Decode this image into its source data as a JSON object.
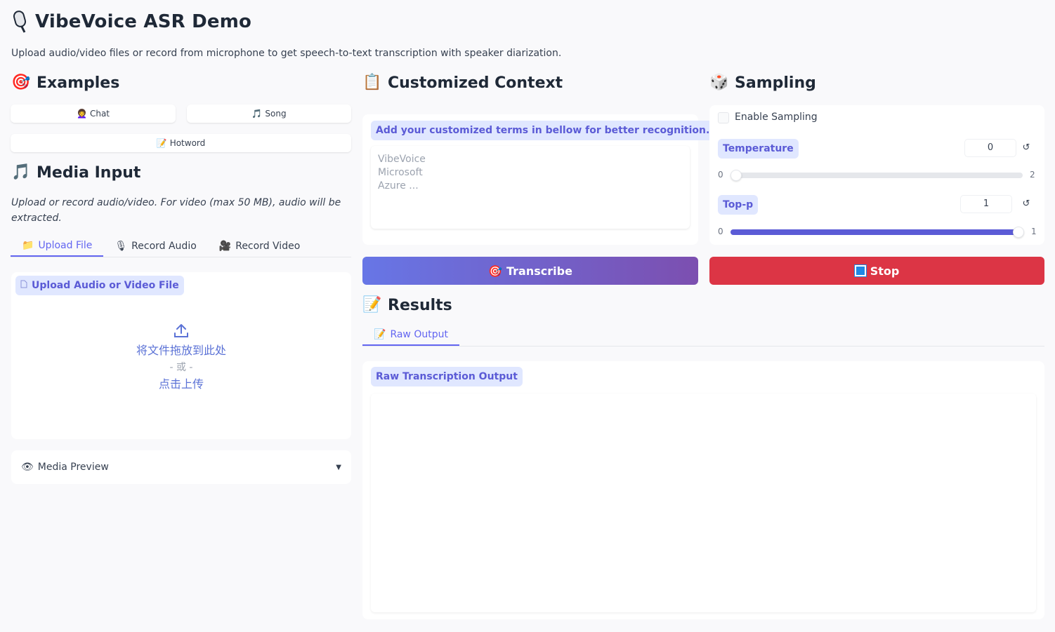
{
  "app": {
    "title": "VibeVoice ASR Demo",
    "subtitle": "Upload audio/video files or record from microphone to get speech-to-text transcription with speaker diarization."
  },
  "examples": {
    "heading": "Examples",
    "icon": "target-icon",
    "buttons": [
      {
        "icon": "👩‍🦱",
        "label": "Chat"
      },
      {
        "icon": "🎵",
        "label": "Song"
      },
      {
        "icon": "📝",
        "label": "Hotword"
      }
    ]
  },
  "media_input": {
    "heading": "Media Input",
    "hint": "Upload or record audio/video. For video (max 50 MB), audio will be extracted.",
    "tabs": [
      {
        "icon": "📁",
        "label": "Upload File",
        "active": true
      },
      {
        "icon": "🎙",
        "label": "Record Audio",
        "active": false
      },
      {
        "icon": "🎥",
        "label": "Record Video",
        "active": false
      }
    ],
    "upload_label": "Upload Audio or Video File",
    "drop_text": "将文件拖放到此处",
    "or_text": "- 或 -",
    "click_text": "点击上传",
    "preview_label": "Media Preview",
    "preview_icon": "👁",
    "caret": "▼"
  },
  "context": {
    "heading": "Customized Context",
    "label": "Add your customized terms in bellow for better recognition.",
    "placeholder": "VibeVoice\nMicrosoft\nAzure ..."
  },
  "sampling": {
    "heading": "Sampling",
    "enable_label": "Enable Sampling",
    "enabled": false,
    "temperature": {
      "label": "Temperature",
      "value": "0",
      "min": "0",
      "max": "2",
      "fraction": 0
    },
    "top_p": {
      "label": "Top-p",
      "value": "1",
      "min": "0",
      "max": "1",
      "fraction": 1
    },
    "reset_glyph": "↺"
  },
  "actions": {
    "transcribe_label": "Transcribe",
    "transcribe_icon": "🎯",
    "stop_label": "Stop"
  },
  "results": {
    "heading": "Results",
    "tab_label": "Raw Output",
    "tab_icon": "📝",
    "output_label": "Raw Transcription Output",
    "output_text": ""
  },
  "colors": {
    "accent": "#6366f1",
    "stop": "#dc3545",
    "transcribe_from": "#6776e6",
    "transcribe_to": "#7c4fb0"
  }
}
